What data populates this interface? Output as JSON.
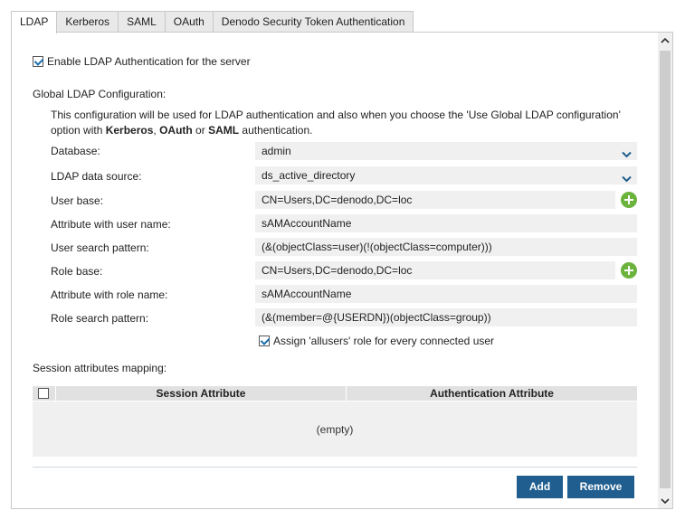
{
  "tabs": [
    {
      "label": "LDAP",
      "active": true
    },
    {
      "label": "Kerberos",
      "active": false
    },
    {
      "label": "SAML",
      "active": false
    },
    {
      "label": "OAuth",
      "active": false
    },
    {
      "label": "Denodo Security Token Authentication",
      "active": false
    }
  ],
  "enable_ldap": {
    "label": "Enable LDAP Authentication for the server",
    "checked": true
  },
  "global_config": {
    "heading": "Global LDAP Configuration:",
    "description": {
      "line1": "This configuration will be used for LDAP authentication and also when you choose the 'Use Global LDAP configuration'",
      "prefix": "option with ",
      "kerberos": "Kerberos",
      "sep1": ", ",
      "oauth": "OAuth",
      "sep2": " or ",
      "saml": "SAML",
      "suffix": " authentication."
    }
  },
  "fields": {
    "database": {
      "label": "Database:",
      "value": "admin"
    },
    "ldap_data_source": {
      "label": "LDAP data source:",
      "value": "ds_active_directory"
    },
    "user_base": {
      "label": "User base:",
      "value": "CN=Users,DC=denodo,DC=loc"
    },
    "attr_user_name": {
      "label": "Attribute with user name:",
      "value": "sAMAccountName"
    },
    "user_search_pattern": {
      "label": "User search pattern:",
      "value": "(&(objectClass=user)(!(objectClass=computer)))"
    },
    "role_base": {
      "label": "Role base:",
      "value": "CN=Users,DC=denodo,DC=loc"
    },
    "attr_role_name": {
      "label": "Attribute with role name:",
      "value": "sAMAccountName"
    },
    "role_search_pattern": {
      "label": "Role search pattern:",
      "value": "(&(member=@{USERDN})(objectClass=group))"
    }
  },
  "assign_allusers": {
    "label": "Assign 'allusers' role for every connected user",
    "checked": true
  },
  "session_mapping": {
    "heading": "Session attributes mapping:",
    "columns": [
      "Session Attribute",
      "Authentication Attribute"
    ],
    "empty_text": "(empty)"
  },
  "buttons": {
    "add": "Add",
    "remove": "Remove"
  },
  "colors": {
    "accent": "#1f5e8e",
    "add_icon": "#6cb33e",
    "field_bg": "#f0f0f0"
  }
}
